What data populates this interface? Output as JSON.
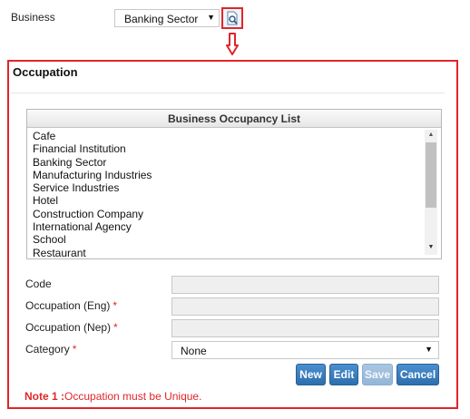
{
  "business": {
    "label": "Business",
    "selected": "Banking Sector"
  },
  "occupation": {
    "title": "Occupation",
    "list": {
      "header": "Business Occupancy List",
      "items": [
        "Cafe",
        "Financial Institution",
        "Banking Sector",
        "Manufacturing Industries",
        "Service Industries",
        "Hotel",
        "Construction Company",
        "International Agency",
        "School",
        "Restaurant"
      ]
    },
    "form": {
      "code_label": "Code",
      "occupation_eng_label": "Occupation (Eng)",
      "occupation_nep_label": "Occupation (Nep)",
      "category_label": "Category",
      "required_mark": "*",
      "category_selected": "None"
    },
    "buttons": {
      "new": "New",
      "edit": "Edit",
      "save": "Save",
      "cancel": "Cancel"
    },
    "note": {
      "prefix": "Note 1 :",
      "text": "Occupation must be Unique."
    }
  },
  "colors": {
    "highlight": "#e0262a",
    "button": "#2d6fae"
  }
}
